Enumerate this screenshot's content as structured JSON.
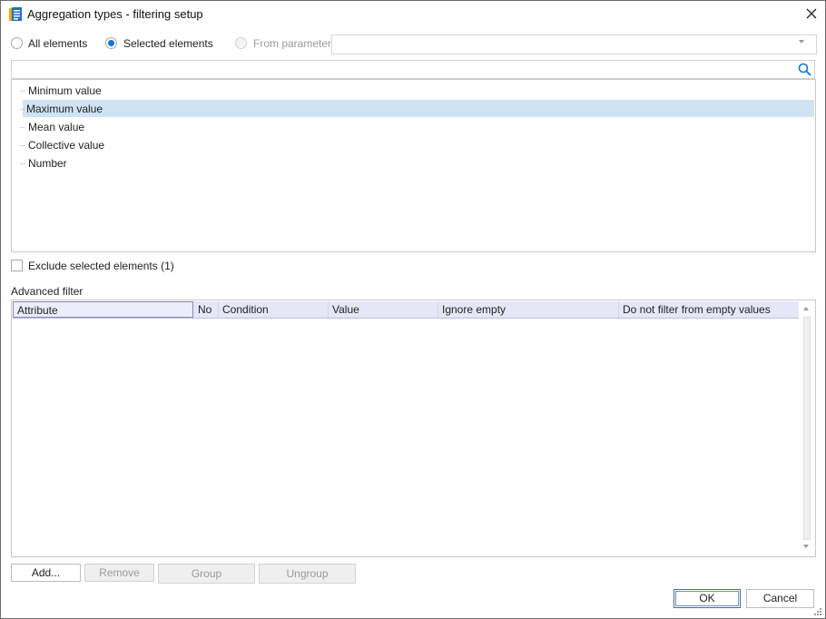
{
  "window": {
    "title": "Aggregation types - filtering setup",
    "close_icon": "close-icon",
    "app_icon": "document-chart-icon"
  },
  "selection_mode": {
    "options": [
      {
        "label": "All elements",
        "selected": false,
        "enabled": true
      },
      {
        "label": "Selected elements",
        "selected": true,
        "enabled": true
      },
      {
        "label": "From parameter:",
        "selected": false,
        "enabled": false
      }
    ],
    "parameter_value": ""
  },
  "search": {
    "value": "",
    "placeholder": "",
    "icon": "search-icon"
  },
  "tree": {
    "items": [
      {
        "label": "Minimum value",
        "selected": false
      },
      {
        "label": "Maximum value",
        "selected": true
      },
      {
        "label": "Mean value",
        "selected": false
      },
      {
        "label": "Collective value",
        "selected": false
      },
      {
        "label": "Number",
        "selected": false
      }
    ]
  },
  "exclude": {
    "label": "Exclude selected elements (1)",
    "checked": false
  },
  "advanced_filter": {
    "label": "Advanced filter",
    "columns": [
      "Attribute",
      "No",
      "Condition",
      "Value",
      "Ignore empty",
      "Do not filter from empty values"
    ],
    "rows": []
  },
  "filter_buttons": {
    "add": "Add...",
    "remove": "Remove",
    "group": "Group",
    "ungroup": "Ungroup"
  },
  "dialog_buttons": {
    "ok": "OK",
    "cancel": "Cancel"
  },
  "colors": {
    "accent": "#0a77d8",
    "selection": "#cfe3f3",
    "grid_header": "#e6e6f8"
  }
}
